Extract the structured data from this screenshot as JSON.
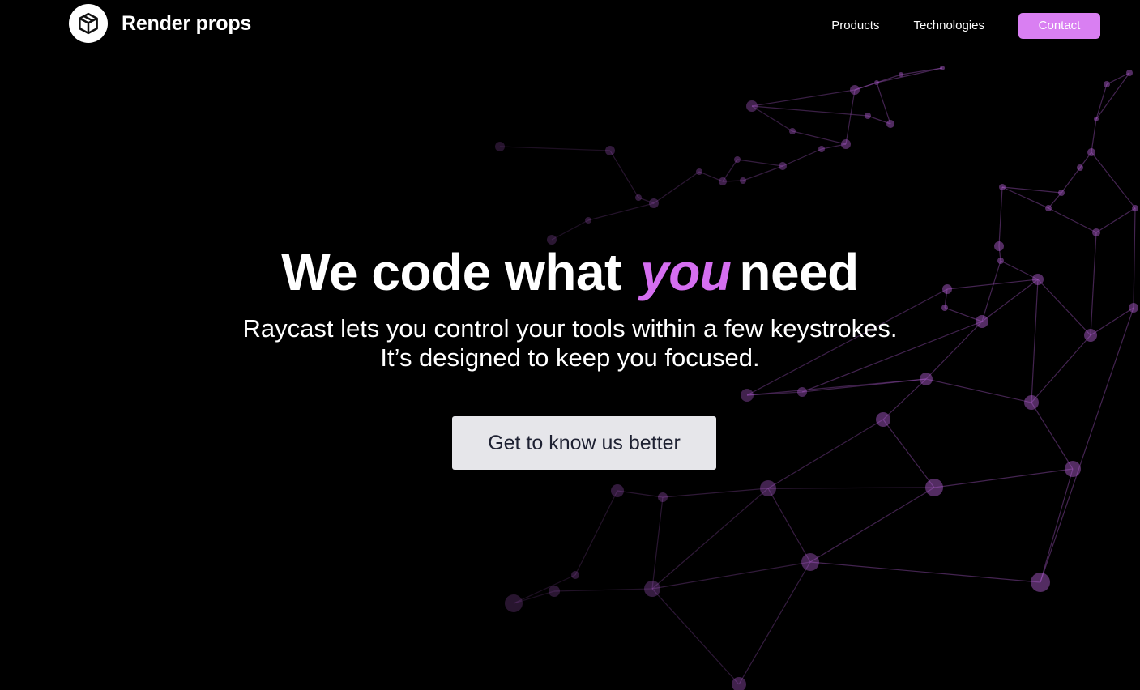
{
  "brand": {
    "name": "Render props",
    "icon": "cube-icon"
  },
  "nav": {
    "products": "Products",
    "technologies": "Technologies",
    "contact": "Contact"
  },
  "hero": {
    "title_before": "We code what ",
    "title_accent": "you",
    "title_after": "need",
    "subtitle_line1": "Raycast lets you control your tools within a few keystrokes.",
    "subtitle_line2": "It’s designed to keep you focused.",
    "cta_label": "Get to know us better"
  },
  "colors": {
    "background": "#000000",
    "accent": "#d56ef0",
    "contact_button": "#d97ff2",
    "cta_background": "#e6e6ea",
    "cta_text": "#1f2233",
    "network": "#b45fd6"
  }
}
